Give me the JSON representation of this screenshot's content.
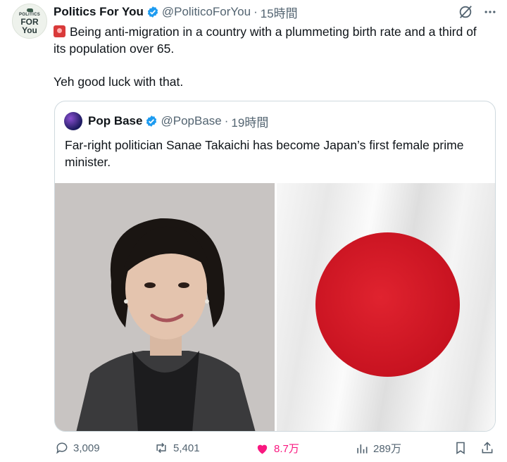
{
  "tweet": {
    "author_name": "Politics For You",
    "author_handle": "@PoliticoForYou",
    "separator": "·",
    "time": "15時間",
    "avatar_text": [
      "POLITICS",
      "FOR",
      "You"
    ],
    "line1": "Being anti-migration in a country with a plummeting birth rate and a third of its population over 65.",
    "line2": "Yeh good luck with that."
  },
  "quoted": {
    "author_name": "Pop Base",
    "author_handle": "@PopBase",
    "separator": "·",
    "time": "19時間",
    "text": "Far-right politician Sanae Takaichi has become Japan’s first female prime minister."
  },
  "actions": {
    "replies": "3,009",
    "retweets": "5,401",
    "likes": "8.7万",
    "views": "289万"
  },
  "colors": {
    "verified": "#1d9bf0",
    "like": "#f91880",
    "muted": "#536471",
    "flag_red": "#c4101e"
  },
  "icons": [
    "grok-icon",
    "more-icon",
    "reply-icon",
    "retweet-icon",
    "heart-icon",
    "views-icon",
    "bookmark-icon",
    "share-icon"
  ]
}
